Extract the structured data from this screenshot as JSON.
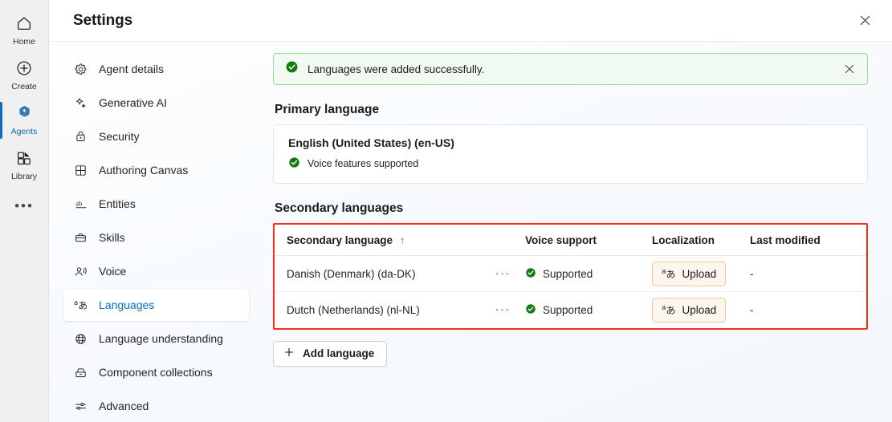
{
  "rail": {
    "items": [
      {
        "label": "Home",
        "icon": "home-icon",
        "selected": false
      },
      {
        "label": "Create",
        "icon": "plus-circle-icon",
        "selected": false
      },
      {
        "label": "Agents",
        "icon": "agents-sparkle-icon",
        "selected": true
      },
      {
        "label": "Library",
        "icon": "library-icon",
        "selected": false
      }
    ],
    "overflow": "•••"
  },
  "header": {
    "title": "Settings",
    "close_label": "Close"
  },
  "settings_nav": {
    "items": [
      {
        "label": "Agent details",
        "icon": "gear-icon",
        "selected": false
      },
      {
        "label": "Generative AI",
        "icon": "sparkle-icon",
        "selected": false
      },
      {
        "label": "Security",
        "icon": "lock-icon",
        "selected": false
      },
      {
        "label": "Authoring Canvas",
        "icon": "canvas-grid-icon",
        "selected": false
      },
      {
        "label": "Entities",
        "icon": "ab-underline-icon",
        "selected": false
      },
      {
        "label": "Skills",
        "icon": "briefcase-icon",
        "selected": false
      },
      {
        "label": "Voice",
        "icon": "voice-person-icon",
        "selected": false
      },
      {
        "label": "Languages",
        "icon": "local-language-icon",
        "selected": true
      },
      {
        "label": "Language understanding",
        "icon": "globe-brain-icon",
        "selected": false
      },
      {
        "label": "Component collections",
        "icon": "component-box-icon",
        "selected": false
      },
      {
        "label": "Advanced",
        "icon": "sliders-icon",
        "selected": false
      }
    ]
  },
  "content": {
    "banner": {
      "text": "Languages were added successfully.",
      "icon": "success-check-icon",
      "close_icon": "close-icon",
      "background": "#f1faf1",
      "border_color": "#9fd89f",
      "accent": "#107c10"
    },
    "primary": {
      "section_title": "Primary language",
      "language": "English (United States) (en-US)",
      "voice_status": "Voice features supported",
      "voice_icon": "success-check-icon"
    },
    "secondary": {
      "section_title": "Secondary languages",
      "highlight_color": "#ff2d1a",
      "columns": [
        "Secondary language",
        "Voice support",
        "Localization",
        "Last modified"
      ],
      "sort_indicator": "↑",
      "rows": [
        {
          "language": "Danish (Denmark) (da-DK)",
          "overflow": "···",
          "voice_support": "Supported",
          "voice_icon": "success-check-icon",
          "localization_label": "Upload",
          "localization_icon": "local-language-icon",
          "last_modified": "-"
        },
        {
          "language": "Dutch (Netherlands) (nl-NL)",
          "overflow": "···",
          "voice_support": "Supported",
          "voice_icon": "success-check-icon",
          "localization_label": "Upload",
          "localization_icon": "local-language-icon",
          "last_modified": "-"
        }
      ]
    },
    "add_language": {
      "label": "Add language",
      "icon": "plus-icon"
    }
  }
}
